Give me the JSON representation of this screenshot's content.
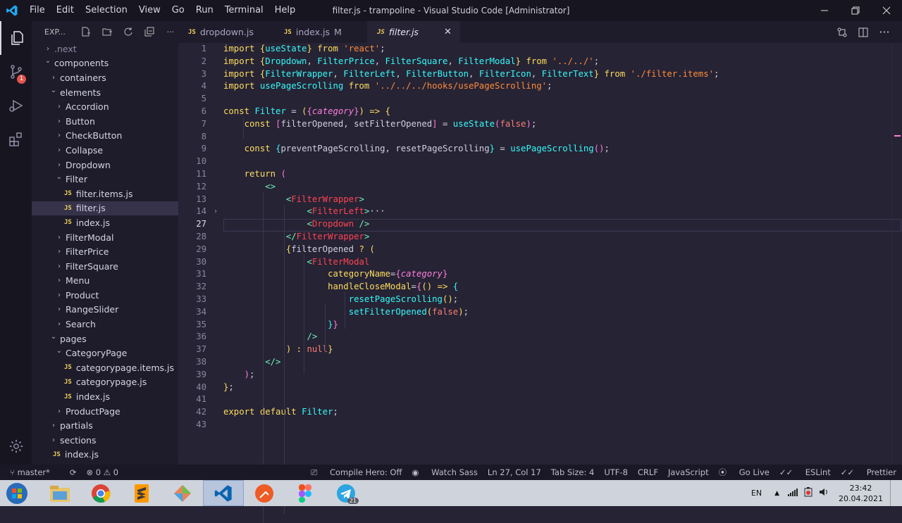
{
  "titlebar": {
    "menu": [
      "File",
      "Edit",
      "Selection",
      "View",
      "Go",
      "Run",
      "Terminal",
      "Help"
    ],
    "title": "filter.js - trampoline - Visual Studio Code [Administrator]"
  },
  "activity_bar": {
    "scm_badge": "1"
  },
  "explorer": {
    "header": "EXP...",
    "tree": [
      {
        "label": ".next",
        "type": "folder",
        "depth": 0,
        "open": false
      },
      {
        "label": "components",
        "type": "folder",
        "depth": 0,
        "open": true
      },
      {
        "label": "containers",
        "type": "folder",
        "depth": 1,
        "open": false
      },
      {
        "label": "elements",
        "type": "folder",
        "depth": 1,
        "open": true
      },
      {
        "label": "Accordion",
        "type": "folder",
        "depth": 2,
        "open": false
      },
      {
        "label": "Button",
        "type": "folder",
        "depth": 2,
        "open": false
      },
      {
        "label": "CheckButton",
        "type": "folder",
        "depth": 2,
        "open": false
      },
      {
        "label": "Collapse",
        "type": "folder",
        "depth": 2,
        "open": false
      },
      {
        "label": "Dropdown",
        "type": "folder",
        "depth": 2,
        "open": false
      },
      {
        "label": "Filter",
        "type": "folder",
        "depth": 2,
        "open": true
      },
      {
        "label": "filter.items.js",
        "type": "js",
        "depth": 3
      },
      {
        "label": "filter.js",
        "type": "js",
        "depth": 3,
        "selected": true
      },
      {
        "label": "index.js",
        "type": "js",
        "depth": 3
      },
      {
        "label": "FilterModal",
        "type": "folder",
        "depth": 2,
        "open": false
      },
      {
        "label": "FilterPrice",
        "type": "folder",
        "depth": 2,
        "open": false
      },
      {
        "label": "FilterSquare",
        "type": "folder",
        "depth": 2,
        "open": false
      },
      {
        "label": "Menu",
        "type": "folder",
        "depth": 2,
        "open": false
      },
      {
        "label": "Product",
        "type": "folder",
        "depth": 2,
        "open": false
      },
      {
        "label": "RangeSlider",
        "type": "folder",
        "depth": 2,
        "open": false
      },
      {
        "label": "Search",
        "type": "folder",
        "depth": 2,
        "open": false
      },
      {
        "label": "pages",
        "type": "folder",
        "depth": 1,
        "open": true
      },
      {
        "label": "CategoryPage",
        "type": "folder",
        "depth": 2,
        "open": true
      },
      {
        "label": "categorypage.items.js",
        "type": "js",
        "depth": 3
      },
      {
        "label": "categorypage.js",
        "type": "js",
        "depth": 3
      },
      {
        "label": "index.js",
        "type": "js",
        "depth": 3
      },
      {
        "label": "ProductPage",
        "type": "folder",
        "depth": 2,
        "open": false
      },
      {
        "label": "partials",
        "type": "folder",
        "depth": 1,
        "open": false
      },
      {
        "label": "sections",
        "type": "folder",
        "depth": 1,
        "open": false
      },
      {
        "label": "index.js",
        "type": "js",
        "depth": 1
      }
    ]
  },
  "tabs": [
    {
      "label": "dropdown.js",
      "modified": "",
      "active": false
    },
    {
      "label": "index.js",
      "modified": "M",
      "active": false
    },
    {
      "label": "filter.js",
      "modified": "",
      "active": true
    }
  ],
  "editor": {
    "lines": [
      {
        "n": "1",
        "html": "<span class='k'>import</span> <span class='p'>{</span><span class='f'>useState</span><span class='p'>}</span> <span class='k'>from</span> <span class='s'>'react'</span><span class='w'>;</span>"
      },
      {
        "n": "2",
        "html": "<span class='k'>import</span> <span class='p'>{</span><span class='f'>Dropdown</span><span class='w'>, </span><span class='f'>FilterPrice</span><span class='w'>, </span><span class='f'>FilterSquare</span><span class='w'>, </span><span class='f'>FilterModal</span><span class='p'>}</span> <span class='k'>from</span> <span class='s'>'../../'</span><span class='w'>;</span>"
      },
      {
        "n": "3",
        "html": "<span class='k'>import</span> <span class='p'>{</span><span class='f'>FilterWrapper</span><span class='w'>, </span><span class='f'>FilterLeft</span><span class='w'>, </span><span class='f'>FilterButton</span><span class='w'>, </span><span class='f'>FilterIcon</span><span class='w'>, </span><span class='f'>FilterText</span><span class='p'>}</span> <span class='k'>from</span> <span class='s'>'./filter.items'</span><span class='w'>;</span>"
      },
      {
        "n": "4",
        "html": "<span class='k'>import</span> <span class='f'>usePageScrolling</span> <span class='k'>from</span> <span class='s'>'../../../hooks/usePageScrolling'</span><span class='w'>;</span>"
      },
      {
        "n": "5",
        "html": ""
      },
      {
        "n": "6",
        "html": "<span class='k'>const</span> <span class='f'>Filter</span> <span class='w'>=</span> <span class='p'>(</span><span class='pk'>{</span><span class='g'>category</span><span class='pk'>}</span><span class='p'>)</span> <span class='k'>=&gt;</span> <span class='p'>{</span>"
      },
      {
        "n": "7",
        "html": "    <span class='k'>const</span> <span class='pk'>[</span><span class='w'>filterOpened, setFilterOpened</span><span class='pk'>]</span> <span class='w'>=</span> <span class='f'>useState</span><span class='pk'>(</span><span class='c'>false</span><span class='pk'>)</span><span class='w'>;</span>"
      },
      {
        "n": "8",
        "html": ""
      },
      {
        "n": "9",
        "html": "    <span class='k'>const</span> <span class='f'>{</span><span class='w'>preventPageScrolling, resetPageScrolling</span><span class='f'>}</span> <span class='w'>=</span> <span class='f'>usePageScrolling</span><span class='pk'>()</span><span class='w'>;</span>"
      },
      {
        "n": "10",
        "html": ""
      },
      {
        "n": "11",
        "html": "    <span class='k'>return</span> <span class='pk'>(</span>"
      },
      {
        "n": "12",
        "html": "        <span class='t'>&lt;&gt;</span>"
      },
      {
        "n": "13",
        "html": "            <span class='t'>&lt;</span><span class='r'>FilterWrapper</span><span class='t'>&gt;</span>"
      },
      {
        "n": "14",
        "html": "                <span class='t'>&lt;</span><span class='r'>FilterLeft</span><span class='t'>&gt;</span><span class='w'>···</span>"
      },
      {
        "n": "27",
        "html": "                <span class='t'>&lt;</span><span class='r'>Dropdown</span> <span class='t'>/&gt;</span>"
      },
      {
        "n": "28",
        "html": "            <span class='t'>&lt;/</span><span class='r'>FilterWrapper</span><span class='t'>&gt;</span>"
      },
      {
        "n": "29",
        "html": "            <span class='p'>{</span><span class='w'>filterOpened</span> <span class='k'>?</span> <span class='p'>(</span>"
      },
      {
        "n": "30",
        "html": "                <span class='t'>&lt;</span><span class='r'>FilterModal</span>"
      },
      {
        "n": "31",
        "html": "                    <span class='p'>categoryName</span><span class='w'>=</span><span class='pk'>{</span><span class='g'>category</span><span class='pk'>}</span>"
      },
      {
        "n": "32",
        "html": "                    <span class='p'>handleCloseModal</span><span class='w'>=</span><span class='pk'>{</span><span class='p'>()</span> <span class='k'>=&gt;</span> <span class='f'>{</span>"
      },
      {
        "n": "33",
        "html": "                        <span class='f'>resetPageScrolling</span><span class='p'>()</span><span class='w'>;</span>"
      },
      {
        "n": "34",
        "html": "                        <span class='f'>setFilterOpened</span><span class='p'>(</span><span class='c'>false</span><span class='p'>)</span><span class='w'>;</span>"
      },
      {
        "n": "35",
        "html": "                    <span class='f'>}</span><span class='pk'>}</span>"
      },
      {
        "n": "36",
        "html": "                <span class='t'>/&gt;</span>"
      },
      {
        "n": "37",
        "html": "            <span class='p'>)</span> <span class='k'>:</span> <span class='c'>null</span><span class='p'>}</span>"
      },
      {
        "n": "38",
        "html": "        <span class='t'>&lt;/&gt;</span>"
      },
      {
        "n": "39",
        "html": "    <span class='pk'>)</span><span class='w'>;</span>"
      },
      {
        "n": "40",
        "html": "<span class='p'>}</span><span class='w'>;</span>"
      },
      {
        "n": "41",
        "html": ""
      },
      {
        "n": "42",
        "html": "<span class='k'>export</span> <span class='k'>default</span> <span class='f'>Filter</span><span class='w'>;</span>"
      },
      {
        "n": "43",
        "html": ""
      }
    ]
  },
  "statusbar": {
    "branch": "master*",
    "problems": "⊗ 0 ⚠ 0",
    "compile_hero": "Compile Hero: Off",
    "watch_sass": "Watch Sass",
    "cursor": "Ln 27, Col 17",
    "tab_size": "Tab Size: 4",
    "encoding": "UTF-8",
    "eol": "CRLF",
    "language": "JavaScript",
    "go_live": "Go Live",
    "eslint": "ESLint",
    "prettier": "Prettier"
  },
  "taskbar": {
    "lang": "EN",
    "time": "23:42",
    "date": "20.04.2021",
    "telegram_badge": "21"
  }
}
